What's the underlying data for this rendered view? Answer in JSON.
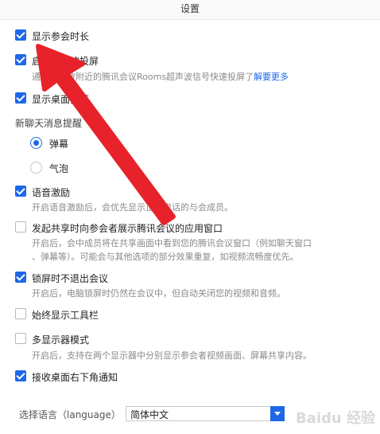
{
  "window": {
    "title": "设置"
  },
  "settings": {
    "show_meeting_duration": {
      "label": "显示参会时长",
      "checked": true
    },
    "ultrasound_share": {
      "label": "启用超声波投屏",
      "desc_prefix": "通过超声波附近的腾讯会议Rooms超声波信号快速投屏了",
      "desc_link": "解要更多",
      "checked": true
    },
    "show_desktop_barrage": {
      "label": "显示桌面弹幕",
      "checked": true
    },
    "new_chat_prompt": {
      "label": "新聊天消息提醒",
      "options": [
        {
          "label": "弹幕",
          "selected": true
        },
        {
          "label": "气泡",
          "selected": false
        }
      ]
    },
    "voice_motivation": {
      "label": "语音激励",
      "desc": "开启语音激励后，会优先显示正在说话的与会成员。",
      "checked": true
    },
    "share_window_to_participants": {
      "label": "发起共享时向参会者展示腾讯会议的应用窗口",
      "desc_line1": "开启后，会中成员将在共享画面中看到您的腾讯会议窗口（例如聊天窗口",
      "desc_line2": "、弹幕等）。可能会与其他选项的部分效果重复，如视频流畅度优先。",
      "checked": false
    },
    "lock_screen_stay": {
      "label": "锁屏时不退出会议",
      "desc": "开启后，电脑锁屏时仍然在会议中，但自动关闭您的视频和音频。",
      "checked": true
    },
    "always_show_toolbar": {
      "label": "始终显示工具栏",
      "checked": false
    },
    "multi_monitor": {
      "label": "多显示器模式",
      "desc": "开启后，支持在两个显示器中分别显示参会者视频画面、屏幕共享内容。",
      "checked": false
    },
    "desktop_notifications": {
      "label": "接收桌面右下角通知",
      "checked": true
    }
  },
  "language": {
    "label": "选择语言（language）",
    "value": "简体中文"
  },
  "watermark": "Baidu 经验",
  "annotation": {
    "arrow_color": "#e8222a"
  }
}
